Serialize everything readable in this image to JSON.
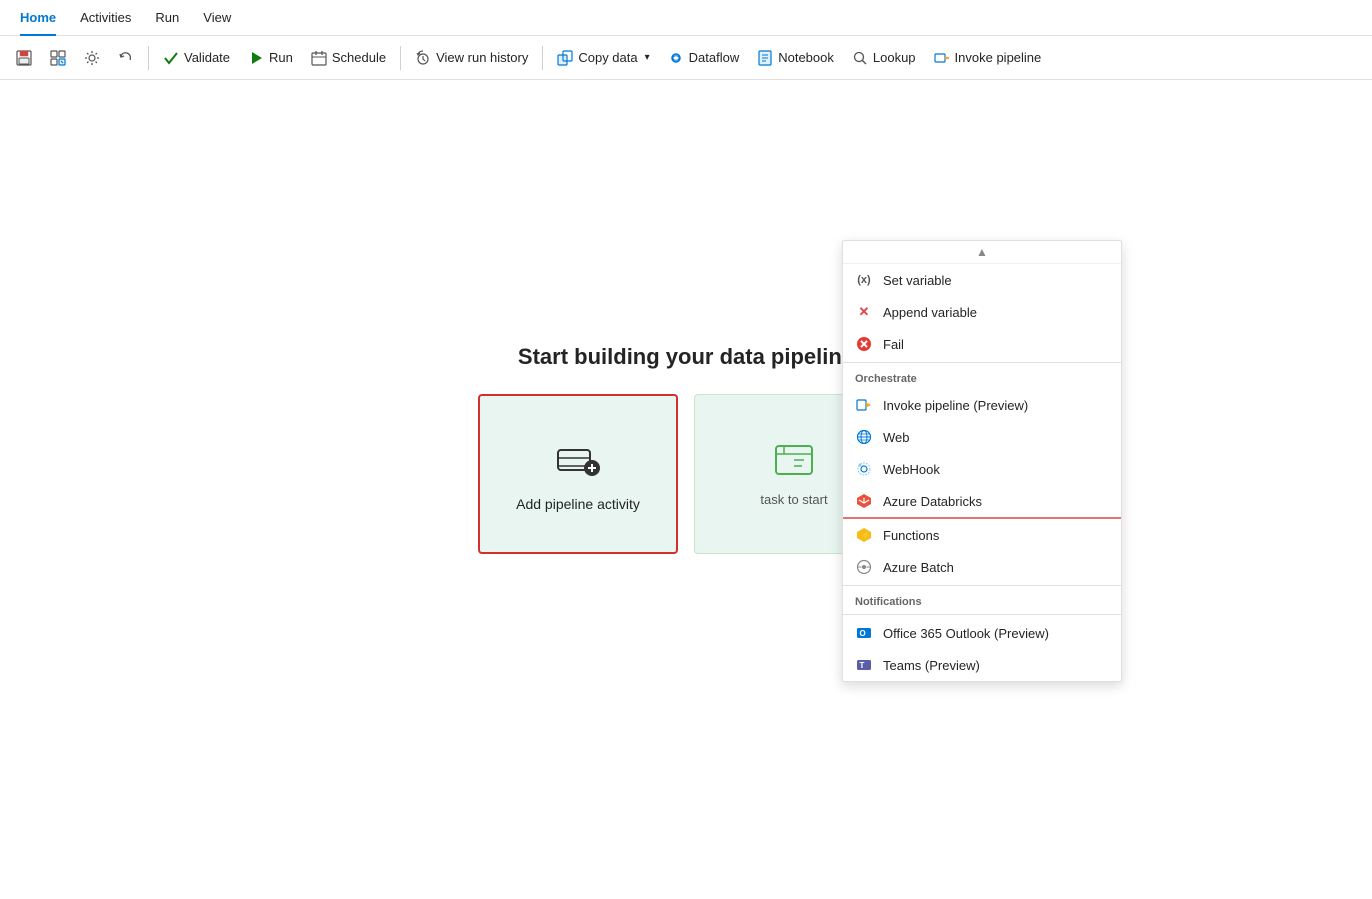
{
  "menuBar": {
    "items": [
      {
        "label": "Home",
        "active": true
      },
      {
        "label": "Activities",
        "active": false
      },
      {
        "label": "Run",
        "active": false
      },
      {
        "label": "View",
        "active": false
      }
    ]
  },
  "toolbar": {
    "buttons": [
      {
        "id": "save",
        "label": "",
        "icon": "save-icon",
        "type": "icon-only"
      },
      {
        "id": "edit",
        "label": "",
        "icon": "edit-icon",
        "type": "icon-only"
      },
      {
        "id": "settings",
        "label": "",
        "icon": "settings-icon",
        "type": "icon-only"
      },
      {
        "id": "undo",
        "label": "",
        "icon": "undo-icon",
        "type": "icon-only"
      },
      {
        "id": "validate",
        "label": "Validate",
        "icon": "check-icon",
        "iconColor": "#107c10"
      },
      {
        "id": "run",
        "label": "Run",
        "icon": "play-icon",
        "iconColor": "#107c10"
      },
      {
        "id": "schedule",
        "label": "Schedule",
        "icon": "calendar-icon"
      },
      {
        "id": "view-run-history",
        "label": "View run history",
        "icon": "history-icon"
      },
      {
        "id": "copy-data",
        "label": "Copy data",
        "icon": "copy-data-icon",
        "hasDropdown": true
      },
      {
        "id": "dataflow",
        "label": "Dataflow",
        "icon": "dataflow-icon"
      },
      {
        "id": "notebook",
        "label": "Notebook",
        "icon": "notebook-icon"
      },
      {
        "id": "lookup",
        "label": "Lookup",
        "icon": "lookup-icon"
      },
      {
        "id": "invoke-pipeline",
        "label": "Invoke pipeline",
        "icon": "invoke-icon"
      }
    ]
  },
  "canvas": {
    "title": "Start building your data pipeline",
    "addActivityCard": {
      "label": "Add pipeline activity"
    },
    "taskCard": {
      "label": "task to start"
    }
  },
  "dropdown": {
    "items": [
      {
        "type": "item",
        "label": "Set variable",
        "icon": "setvariable-icon",
        "iconSymbol": "(x)"
      },
      {
        "type": "item",
        "label": "Append variable",
        "icon": "appendvar-icon",
        "iconSymbol": "✕"
      },
      {
        "type": "item",
        "label": "Fail",
        "icon": "fail-icon",
        "iconSymbol": "fail",
        "underlined": false
      },
      {
        "type": "section",
        "label": "Orchestrate"
      },
      {
        "type": "item",
        "label": "Invoke pipeline (Preview)",
        "icon": "invoke-pipeline-icon",
        "iconSymbol": "invoke"
      },
      {
        "type": "item",
        "label": "Web",
        "icon": "web-icon",
        "iconSymbol": "web"
      },
      {
        "type": "item",
        "label": "WebHook",
        "icon": "webhook-icon",
        "iconSymbol": "webhook"
      },
      {
        "type": "item",
        "label": "Azure Databricks",
        "icon": "databricks-icon",
        "iconSymbol": "databricks",
        "underlined": true
      },
      {
        "type": "item",
        "label": "Functions",
        "icon": "functions-icon",
        "iconSymbol": "functions"
      },
      {
        "type": "item",
        "label": "Azure Batch",
        "icon": "azurebatch-icon",
        "iconSymbol": "batch"
      },
      {
        "type": "section",
        "label": "Notifications"
      },
      {
        "type": "divider"
      },
      {
        "type": "item",
        "label": "Office 365 Outlook (Preview)",
        "icon": "office-icon",
        "iconSymbol": "o365"
      },
      {
        "type": "item",
        "label": "Teams (Preview)",
        "icon": "teams-icon",
        "iconSymbol": "teams"
      }
    ]
  }
}
